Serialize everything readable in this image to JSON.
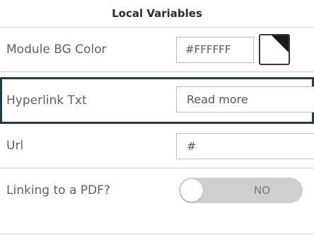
{
  "panel": {
    "title": "Local Variables"
  },
  "rows": {
    "module_bg": {
      "label": "Module BG Color",
      "value": "#FFFFFF",
      "swatch_color": "#FFFFFF"
    },
    "hyperlink": {
      "label": "Hyperlink Txt",
      "value": "Read more"
    },
    "url": {
      "label": "Url",
      "value": "#"
    },
    "pdf": {
      "label": "Linking to a PDF?",
      "toggle_state": "NO"
    }
  },
  "colors": {
    "selected_border": "#253a45",
    "divider": "#cfcfcf",
    "toggle_track": "#cfcfcf"
  }
}
